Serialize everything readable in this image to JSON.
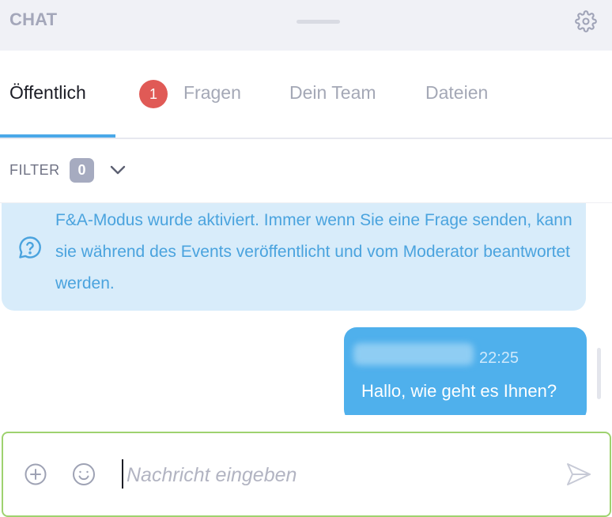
{
  "header": {
    "title": "CHAT",
    "settings_icon": "gear-icon"
  },
  "tabs": [
    {
      "label": "Öffentlich",
      "active": true
    },
    {
      "label": "Fragen",
      "badge": "1"
    },
    {
      "label": "Dein Team"
    },
    {
      "label": "Dateien"
    }
  ],
  "filter": {
    "label": "FILTER",
    "count": "0",
    "expand_icon": "chevron-down-icon"
  },
  "info": {
    "icon": "question-bubble-icon",
    "text": "F&A-Modus wurde aktiviert. Immer wenn Sie eine Frage senden, kann sie während des Events veröffentlicht und vom Moderator beantwortet werden."
  },
  "message": {
    "time": "22:25",
    "text": "Hallo, wie geht es Ihnen?"
  },
  "composer": {
    "placeholder": "Nachricht eingeben",
    "value": "",
    "attach_icon": "plus-circle-icon",
    "emoji_icon": "smiley-icon",
    "send_icon": "send-icon"
  },
  "colors": {
    "accent": "#4aa8e8",
    "bubble": "#4fb0ec",
    "info_bg": "#d8ecfa",
    "badge": "#e05a56",
    "composer_border": "#9ed26f"
  }
}
